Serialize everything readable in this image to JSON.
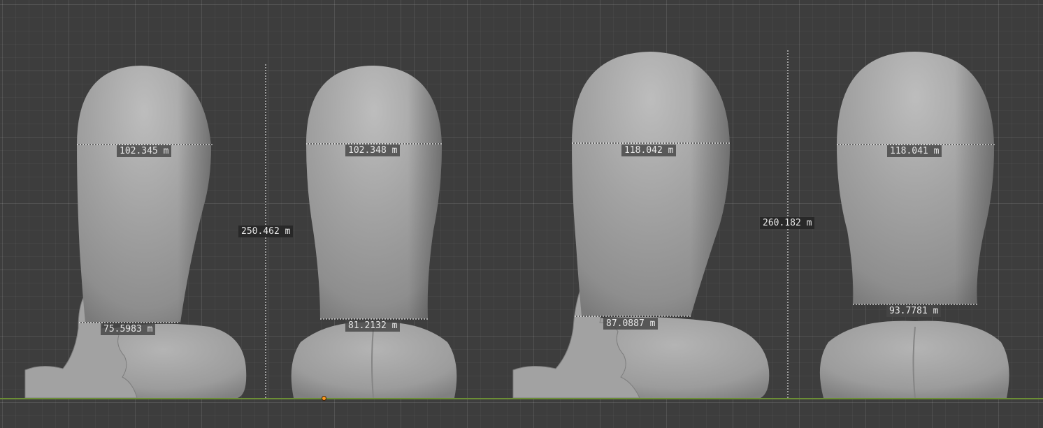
{
  "viewport": {
    "background_color": "#3d3d3d",
    "x_axis_color": "#6b8e35",
    "origin_color": "#ff9a1f",
    "mesh_color": "#a8a8a8"
  },
  "measurements": {
    "m1_top": "102.345 m",
    "m1_bottom": "75.5983 m",
    "m2_top": "102.348 m",
    "m2_bottom": "81.2132 m",
    "height_left": "250.462 m",
    "m3_top": "118.042 m",
    "m3_bottom": "87.0887 m",
    "m4_top": "118.041 m",
    "m4_bottom": "93.7781 m",
    "height_right": "260.182 m"
  }
}
